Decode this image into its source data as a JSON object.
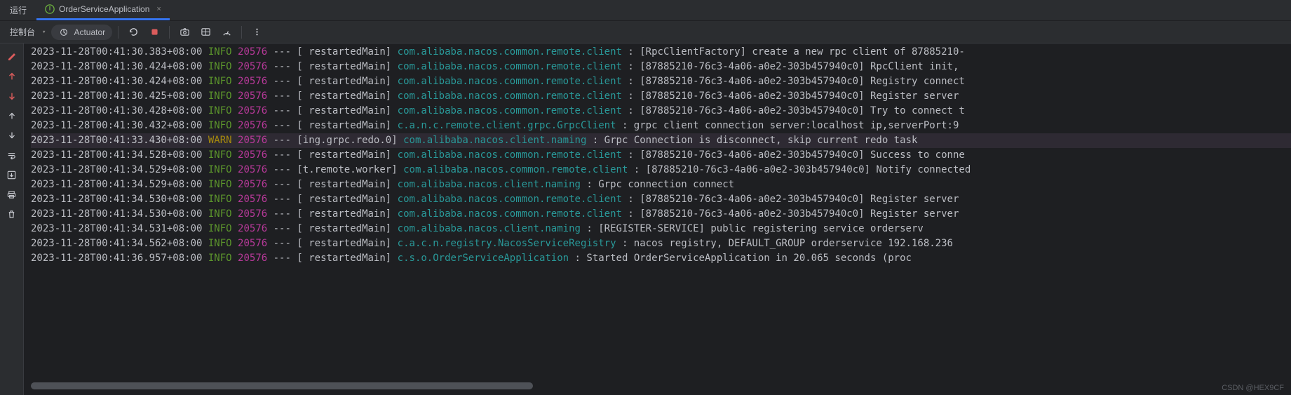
{
  "tabs": {
    "run": "运行",
    "app": "OrderServiceApplication",
    "close": "×"
  },
  "toolbar": {
    "console": "控制台",
    "actuator": "Actuator"
  },
  "watermark": "CSDN @HEX9CF",
  "logs": [
    {
      "ts": "2023-11-28T00:41:30.383+08:00",
      "level": "INFO",
      "pid": "20576",
      "thread": "  restartedMain",
      "logger": "com.alibaba.nacos.common.remote.client   ",
      "msg": "[RpcClientFactory] create a new rpc client of 87885210-"
    },
    {
      "ts": "2023-11-28T00:41:30.424+08:00",
      "level": "INFO",
      "pid": "20576",
      "thread": "  restartedMain",
      "logger": "com.alibaba.nacos.common.remote.client   ",
      "msg": "[87885210-76c3-4a06-a0e2-303b457940c0] RpcClient init,"
    },
    {
      "ts": "2023-11-28T00:41:30.424+08:00",
      "level": "INFO",
      "pid": "20576",
      "thread": "  restartedMain",
      "logger": "com.alibaba.nacos.common.remote.client   ",
      "msg": "[87885210-76c3-4a06-a0e2-303b457940c0] Registry connect"
    },
    {
      "ts": "2023-11-28T00:41:30.425+08:00",
      "level": "INFO",
      "pid": "20576",
      "thread": "  restartedMain",
      "logger": "com.alibaba.nacos.common.remote.client   ",
      "msg": "[87885210-76c3-4a06-a0e2-303b457940c0] Register server "
    },
    {
      "ts": "2023-11-28T00:41:30.428+08:00",
      "level": "INFO",
      "pid": "20576",
      "thread": "  restartedMain",
      "logger": "com.alibaba.nacos.common.remote.client   ",
      "msg": "[87885210-76c3-4a06-a0e2-303b457940c0] Try to connect t"
    },
    {
      "ts": "2023-11-28T00:41:30.432+08:00",
      "level": "INFO",
      "pid": "20576",
      "thread": "  restartedMain",
      "logger": "c.a.n.c.remote.client.grpc.GrpcClient    ",
      "msg": "grpc client connection server:localhost ip,serverPort:9"
    },
    {
      "ts": "2023-11-28T00:41:33.430+08:00",
      "level": "WARN",
      "pid": "20576",
      "thread": "ing.grpc.redo.0",
      "logger": "com.alibaba.nacos.client.naming          ",
      "msg": "Grpc Connection is disconnect, skip current redo task "
    },
    {
      "ts": "2023-11-28T00:41:34.528+08:00",
      "level": "INFO",
      "pid": "20576",
      "thread": "  restartedMain",
      "logger": "com.alibaba.nacos.common.remote.client   ",
      "msg": "[87885210-76c3-4a06-a0e2-303b457940c0] Success to conne"
    },
    {
      "ts": "2023-11-28T00:41:34.529+08:00",
      "level": "INFO",
      "pid": "20576",
      "thread": "t.remote.worker",
      "logger": "com.alibaba.nacos.common.remote.client   ",
      "msg": "[87885210-76c3-4a06-a0e2-303b457940c0] Notify connected"
    },
    {
      "ts": "2023-11-28T00:41:34.529+08:00",
      "level": "INFO",
      "pid": "20576",
      "thread": "  restartedMain",
      "logger": "com.alibaba.nacos.client.naming          ",
      "msg": "Grpc connection connect"
    },
    {
      "ts": "2023-11-28T00:41:34.530+08:00",
      "level": "INFO",
      "pid": "20576",
      "thread": "  restartedMain",
      "logger": "com.alibaba.nacos.common.remote.client   ",
      "msg": "[87885210-76c3-4a06-a0e2-303b457940c0] Register server "
    },
    {
      "ts": "2023-11-28T00:41:34.530+08:00",
      "level": "INFO",
      "pid": "20576",
      "thread": "  restartedMain",
      "logger": "com.alibaba.nacos.common.remote.client   ",
      "msg": "[87885210-76c3-4a06-a0e2-303b457940c0] Register server "
    },
    {
      "ts": "2023-11-28T00:41:34.531+08:00",
      "level": "INFO",
      "pid": "20576",
      "thread": "  restartedMain",
      "logger": "com.alibaba.nacos.client.naming          ",
      "msg": "[REGISTER-SERVICE] public registering service orderserv"
    },
    {
      "ts": "2023-11-28T00:41:34.562+08:00",
      "level": "INFO",
      "pid": "20576",
      "thread": "  restartedMain",
      "logger": "c.a.c.n.registry.NacosServiceRegistry    ",
      "msg": "nacos registry, DEFAULT_GROUP orderservice 192.168.236"
    },
    {
      "ts": "2023-11-28T00:41:36.957+08:00",
      "level": "INFO",
      "pid": "20576",
      "thread": "  restartedMain",
      "logger": "c.s.o.OrderServiceApplication            ",
      "msg": "Started OrderServiceApplication in 20.065 seconds (proc"
    }
  ]
}
